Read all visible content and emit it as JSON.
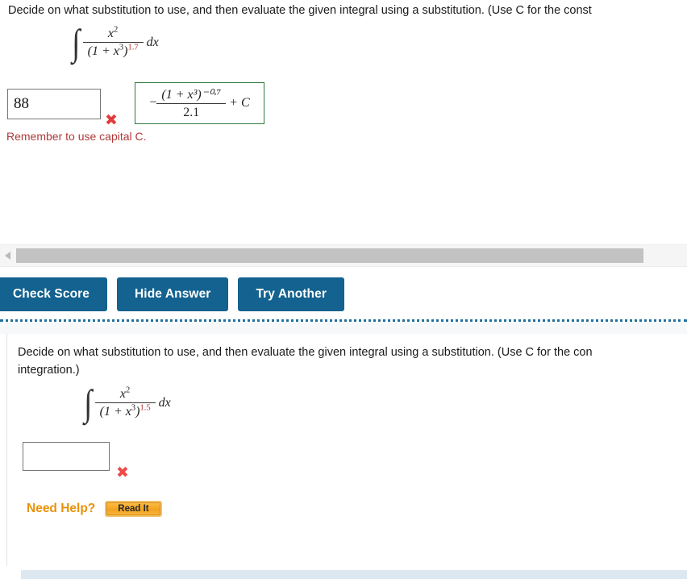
{
  "problem_one": {
    "prompt": "Decide on what substitution to use, and then evaluate the given integral using a substitution. (Use C for the const",
    "integral": {
      "numerator": "x",
      "numerator_exponent": "2",
      "denominator_base": "(1 + x",
      "denominator_inner_exponent": "3",
      "denominator_close": ")",
      "denominator_exponent": "1.7",
      "differential": "dx"
    },
    "student_answer": "88",
    "result_mark": "✖",
    "correct_answer": {
      "sign": "−",
      "numerator": "(1 + x³)⁻⁰·⁷",
      "denominator": "2.1",
      "constant": "+ C"
    },
    "feedback_note": "Remember to use capital C."
  },
  "toolbar": {
    "check_score_label": "Check Score",
    "hide_answer_label": "Hide Answer",
    "try_another_label": "Try Another"
  },
  "scrollbar": {
    "left_arrow_icon": "left-arrow-icon"
  },
  "problem_two": {
    "prompt_line1": "Decide on what substitution to use, and then evaluate the given integral using a substitution. (Use C for the con",
    "prompt_line2": "integration.)",
    "integral": {
      "numerator": "x",
      "numerator_exponent": "2",
      "denominator_base": "(1 + x",
      "denominator_inner_exponent": "3",
      "denominator_close": ")",
      "denominator_exponent": "1.5",
      "differential": "dx"
    },
    "student_answer": "",
    "input_placeholder": "",
    "result_mark": "✖",
    "need_help_label": "Need Help?",
    "read_it_label": "Read It"
  },
  "colors": {
    "button_blue": "#13628f",
    "correct_green": "#2d7a3e",
    "wrong_red": "#e23b3b",
    "note_red": "#b03a3a",
    "exponent_red": "#b03030",
    "help_orange": "#e8920a",
    "read_it_orange": "#f5a623",
    "separator_blue": "#1f6f9c",
    "scrollbar_thumb": "#c2c2c2",
    "bottom_bar_blue": "#dde7ef"
  }
}
